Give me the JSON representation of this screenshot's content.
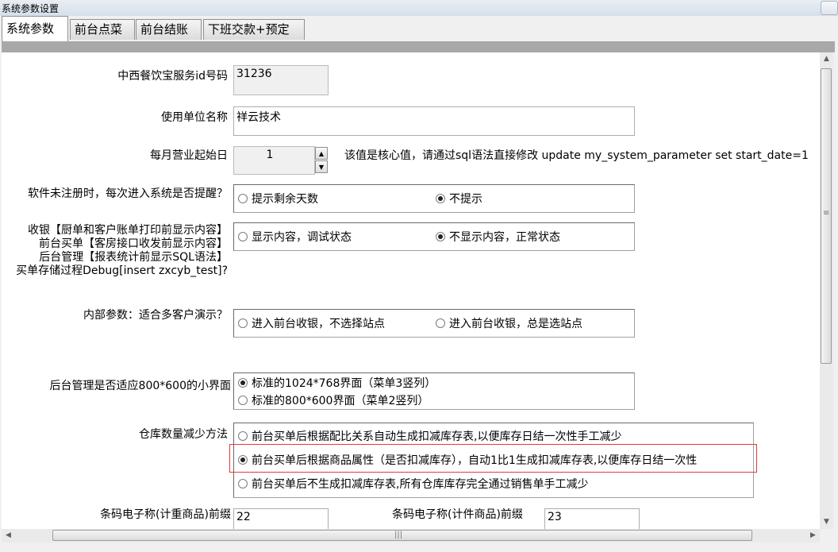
{
  "window": {
    "title": "系统参数设置"
  },
  "tabs": [
    {
      "label": "系统参数",
      "active": true
    },
    {
      "label": "前台点菜",
      "active": false
    },
    {
      "label": "前台结账",
      "active": false
    },
    {
      "label": "下班交款+预定",
      "active": false
    }
  ],
  "fields": {
    "service_id": {
      "label": "中西餐饮宝服务id号码",
      "value": "31236"
    },
    "unit_name": {
      "label": "使用单位名称",
      "value": "祥云技术"
    },
    "start_day": {
      "label": "每月营业起始日",
      "value": "1",
      "note": "该值是核心值，请通过sql语法直接修改 update my_system_parameter set  start_date=1"
    },
    "unregistered": {
      "label": "软件未注册时，每次进入系统是否提醒？",
      "options": [
        "提示剩余天数",
        "不提示"
      ],
      "selected": 1
    },
    "debug": {
      "label_lines": [
        "收银【厨单和客户账单打印前显示内容】",
        "前台买单【客房接口收发前显示内容】",
        "后台管理【报表统计前显示SQL语法】",
        "买单存储过程Debug[insert zxcyb_test]?"
      ],
      "options": [
        "显示内容，调试状态",
        "不显示内容，正常状态"
      ],
      "selected": 1
    },
    "demo": {
      "label": "内部参数：适合多客户演示？",
      "options": [
        "进入前台收银，不选择站点",
        "进入前台收银，总是选站点"
      ],
      "selected": -1
    },
    "small_ui": {
      "label": "后台管理是否适应800*600的小界面",
      "options": [
        "标准的1024*768界面（菜单3竖列）",
        "标准的800*600界面（菜单2竖列）"
      ],
      "selected": 0
    },
    "stock": {
      "label": "仓库数量减少方法",
      "options": [
        "前台买单后根据配比关系自动生成扣减库存表,以便库存日结一次性手工减少",
        "前台买单后根据商品属性（是否扣减库存），自动1比1生成扣减库存表,以便库存日结一次性",
        "前台买单后不生成扣减库存表,所有仓库库存完全通过销售单手工减少"
      ],
      "selected": 1
    },
    "barcode_weight": {
      "label": "条码电子称(计重商品)前缀",
      "value": "22"
    },
    "barcode_count": {
      "label": "条码电子称(计件商品)前缀",
      "value": "23"
    }
  },
  "icons": {
    "spin_up": "▲",
    "spin_down": "▼",
    "scroll_up": "▲",
    "scroll_down": "▼",
    "scroll_left": "◀",
    "scroll_right": "▶",
    "grip_v": "≡",
    "grip_h": "|||"
  }
}
